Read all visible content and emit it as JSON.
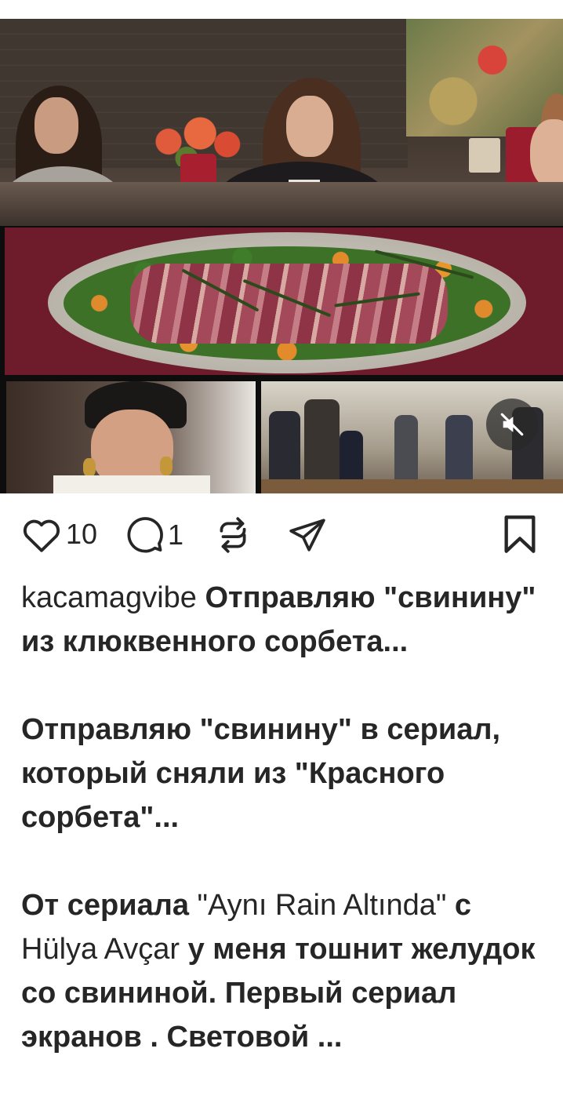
{
  "post": {
    "media": {
      "alt_panels": [
        "dining-scene",
        "roast-platter",
        "woman-in-turban",
        "ballroom-scene"
      ],
      "mute_icon": "speaker-muted-icon",
      "accent_colors": {
        "wine": "#6e1b2b",
        "mute_button_bg": "#282828"
      }
    },
    "actions": {
      "like_icon": "heart-outline-icon",
      "like_count": "10",
      "comment_icon": "comment-bubble-icon",
      "comment_count": "1",
      "repost_icon": "repost-arrows-icon",
      "share_icon": "send-paper-plane-icon",
      "save_icon": "bookmark-outline-icon"
    },
    "caption": {
      "username": "kacamagvibe",
      "p1": "Отправляю \"свинину\" из клюквенного сорбета...",
      "p2": "Отправляю \"свинину\" в сериал, который сняли из \"Красного сорбета\"...",
      "p3_a": "От сериала ",
      "p3_b": "\"Aynı Rain Altında\"",
      "p3_c": " с ",
      "p3_d": "Hülya Avçar",
      "p3_e": " у меня тошнит желудок со свининой. Первый сериал экранов . Световой ..."
    }
  }
}
